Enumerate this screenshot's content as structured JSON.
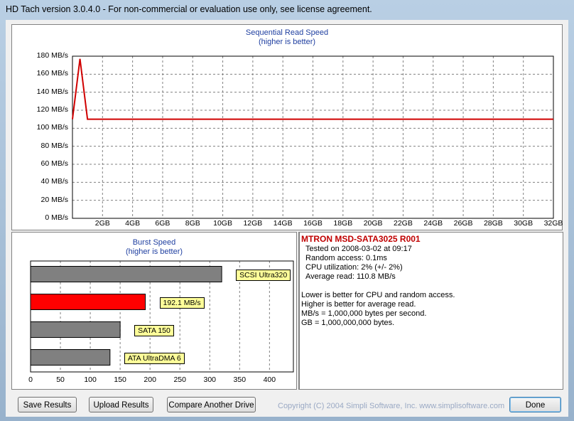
{
  "window": {
    "title": "HD Tach version 3.0.4.0  - For non-commercial or evaluation use only, see license agreement."
  },
  "sequential": {
    "title": "Sequential Read Speed",
    "subtitle": "(higher is better)"
  },
  "burst": {
    "title": "Burst Speed",
    "subtitle": "(higher is better)"
  },
  "chart_data": [
    {
      "type": "line",
      "title": "Sequential Read Speed",
      "subtitle": "(higher is better)",
      "y_ticks": [
        "0 MB/s",
        "20 MB/s",
        "40 MB/s",
        "60 MB/s",
        "80 MB/s",
        "100 MB/s",
        "120 MB/s",
        "140 MB/s",
        "160 MB/s",
        "180 MB/s"
      ],
      "x_ticks": [
        "2GB",
        "4GB",
        "6GB",
        "8GB",
        "10GB",
        "12GB",
        "14GB",
        "16GB",
        "18GB",
        "20GB",
        "22GB",
        "24GB",
        "26GB",
        "28GB",
        "30GB",
        "32GB"
      ],
      "ylim": [
        0,
        180
      ],
      "xlim": [
        0,
        32
      ],
      "grid": true,
      "series": [
        {
          "color": "#d00000",
          "x": [
            0,
            0.5,
            1.0,
            32
          ],
          "y": [
            110,
            177,
            110,
            110
          ]
        }
      ]
    },
    {
      "type": "bar",
      "orientation": "horizontal",
      "title": "Burst Speed",
      "subtitle": "(higher is better)",
      "x_ticks": [
        "0",
        "50",
        "100",
        "150",
        "200",
        "250",
        "300",
        "350",
        "400"
      ],
      "xlim": [
        0,
        440
      ],
      "grid": true,
      "bars": [
        {
          "label": "SCSI Ultra320",
          "value": 320,
          "color": "#808080"
        },
        {
          "label": "192.1 MB/s",
          "value": 192.1,
          "color": "#ff0000"
        },
        {
          "label": "SATA 150",
          "value": 150,
          "color": "#808080"
        },
        {
          "label": "ATA UltraDMA 6",
          "value": 133,
          "color": "#808080"
        }
      ]
    }
  ],
  "info": {
    "drive": "MTRON MSD-SATA3025 R001",
    "tested": "Tested on 2008-03-02 at 09:17",
    "random_access": "Random access: 0.1ms",
    "cpu": "CPU utilization: 2% (+/- 2%)",
    "average": "Average read: 110.8 MB/s",
    "note1": "Lower is better for CPU and random access.",
    "note2": "Higher is better for average read.",
    "note3": "MB/s = 1,000,000 bytes per second.",
    "note4": "GB = 1,000,000,000 bytes."
  },
  "buttons": {
    "save": "Save Results",
    "upload": "Upload Results",
    "compare": "Compare Another Drive",
    "done": "Done"
  },
  "footer": {
    "copyright": "Copyright (C) 2004 Simpli Software, Inc. www.simplisoftware.com"
  }
}
